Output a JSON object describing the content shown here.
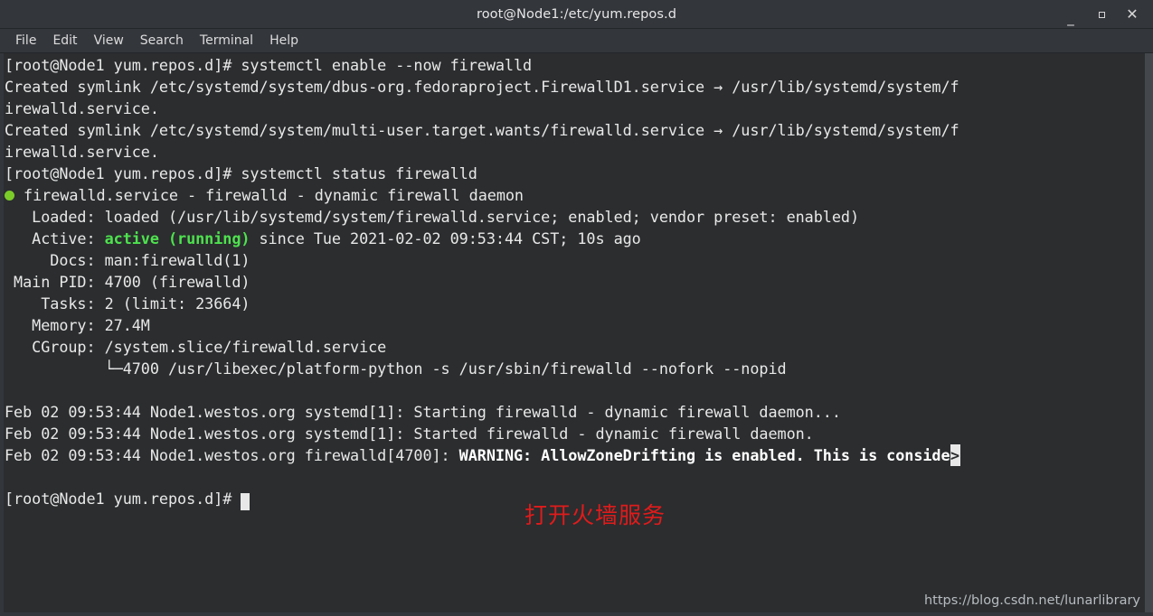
{
  "window": {
    "title": "root@Node1:/etc/yum.repos.d",
    "controls": {
      "minimize": "_",
      "maximize": "",
      "close": "✕"
    }
  },
  "menubar": {
    "items": [
      {
        "label": "File"
      },
      {
        "label": "Edit"
      },
      {
        "label": "View"
      },
      {
        "label": "Search"
      },
      {
        "label": "Terminal"
      },
      {
        "label": "Help"
      }
    ]
  },
  "terminal": {
    "prompt": "[root@Node1 yum.repos.d]#",
    "lines": [
      {
        "id": "l01",
        "text": "[root@Node1 yum.repos.d]# systemctl enable --now firewalld"
      },
      {
        "id": "l02",
        "text": "Created symlink /etc/systemd/system/dbus-org.fedoraproject.FirewallD1.service → /usr/lib/systemd/system/f"
      },
      {
        "id": "l03",
        "text": "irewalld.service."
      },
      {
        "id": "l04",
        "text": "Created symlink /etc/systemd/system/multi-user.target.wants/firewalld.service → /usr/lib/systemd/system/f"
      },
      {
        "id": "l05",
        "text": "irewalld.service."
      },
      {
        "id": "l06",
        "text": "[root@Node1 yum.repos.d]# systemctl status firewalld"
      },
      {
        "id": "l07",
        "text": " firewalld.service - firewalld - dynamic firewall daemon"
      },
      {
        "id": "l08",
        "text": "   Loaded: loaded (/usr/lib/systemd/system/firewalld.service; enabled; vendor preset: enabled)"
      },
      {
        "id": "l09a",
        "text": "   Active: "
      },
      {
        "id": "l09b",
        "text": "active (running)"
      },
      {
        "id": "l09c",
        "text": " since Tue 2021-02-02 09:53:44 CST; 10s ago"
      },
      {
        "id": "l10",
        "text": "     Docs: man:firewalld(1)"
      },
      {
        "id": "l11",
        "text": " Main PID: 4700 (firewalld)"
      },
      {
        "id": "l12",
        "text": "    Tasks: 2 (limit: 23664)"
      },
      {
        "id": "l13",
        "text": "   Memory: 27.4M"
      },
      {
        "id": "l14",
        "text": "   CGroup: /system.slice/firewalld.service"
      },
      {
        "id": "l15",
        "text": "           └─4700 /usr/libexec/platform-python -s /usr/sbin/firewalld --nofork --nopid"
      },
      {
        "id": "l16",
        "text": ""
      },
      {
        "id": "l17",
        "text": "Feb 02 09:53:44 Node1.westos.org systemd[1]: Starting firewalld - dynamic firewall daemon..."
      },
      {
        "id": "l18",
        "text": "Feb 02 09:53:44 Node1.westos.org systemd[1]: Started firewalld - dynamic firewall daemon."
      },
      {
        "id": "l19a",
        "text": "Feb 02 09:53:44 Node1.westos.org firewalld[4700]: "
      },
      {
        "id": "l19b",
        "text": "WARNING: AllowZoneDrifting is enabled. This is conside"
      },
      {
        "id": "l19c",
        "text": ">"
      },
      {
        "id": "l20",
        "text": ""
      },
      {
        "id": "l21",
        "text": "[root@Node1 yum.repos.d]# "
      }
    ],
    "status_dot": "green-status-dot"
  },
  "annotation": {
    "text": "打开火墙服务",
    "color": "#e01b1b"
  },
  "watermark": {
    "text": "https://blog.csdn.net/lunarlibrary"
  },
  "colors": {
    "terminal_bg": "#2b2d2f",
    "chrome_bg": "#33363b",
    "text": "#e8e8e8",
    "green": "#4ee24e",
    "dot_green": "#7ccc29"
  }
}
